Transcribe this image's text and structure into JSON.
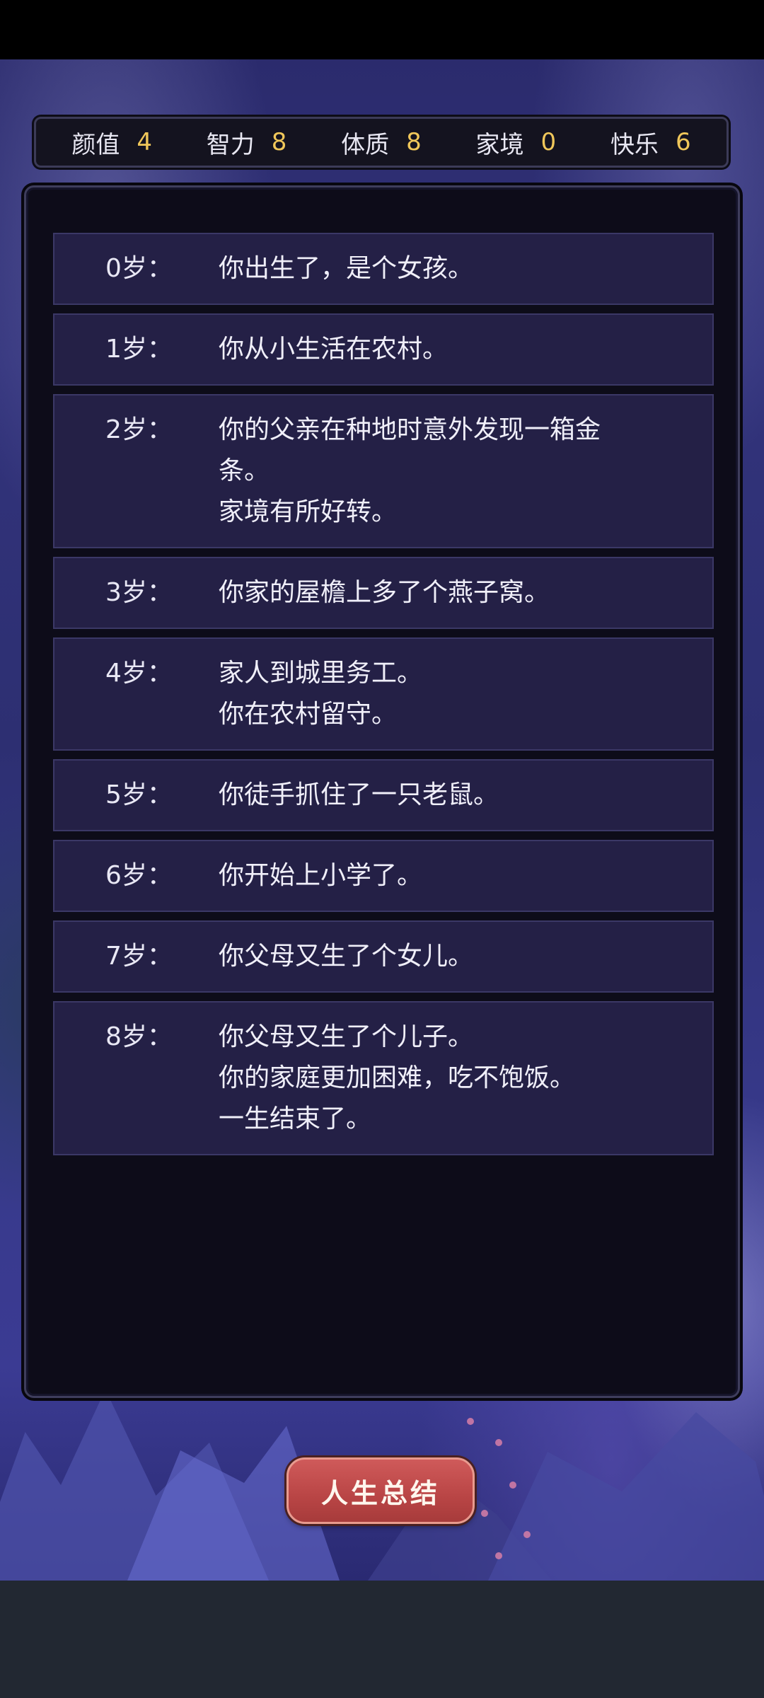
{
  "attributes": [
    {
      "name": "颜值",
      "value": "4"
    },
    {
      "name": "智力",
      "value": "8"
    },
    {
      "name": "体质",
      "value": "8"
    },
    {
      "name": "家境",
      "value": "0"
    },
    {
      "name": "快乐",
      "value": "6"
    }
  ],
  "events": [
    {
      "age": "0岁：",
      "lines": [
        "你出生了，是个女孩。"
      ]
    },
    {
      "age": "1岁：",
      "lines": [
        "你从小生活在农村。"
      ]
    },
    {
      "age": "2岁：",
      "lines": [
        "你的父亲在种地时意外发现一箱金",
        "条。",
        "家境有所好转。"
      ]
    },
    {
      "age": "3岁：",
      "lines": [
        "你家的屋檐上多了个燕子窝。"
      ]
    },
    {
      "age": "4岁：",
      "lines": [
        "家人到城里务工。",
        "你在农村留守。"
      ]
    },
    {
      "age": "5岁：",
      "lines": [
        "你徒手抓住了一只老鼠。"
      ]
    },
    {
      "age": "6岁：",
      "lines": [
        "你开始上小学了。"
      ]
    },
    {
      "age": "7岁：",
      "lines": [
        "你父母又生了个女儿。"
      ]
    },
    {
      "age": "8岁：",
      "lines": [
        "你父母又生了个儿子。",
        "你的家庭更加困难，吃不饱饭。",
        "一生结束了。"
      ]
    }
  ],
  "summary_button": "人生总结",
  "colors": {
    "attribute_value": "#f0c75a",
    "event_background": "#242046",
    "button": "#b94545"
  }
}
